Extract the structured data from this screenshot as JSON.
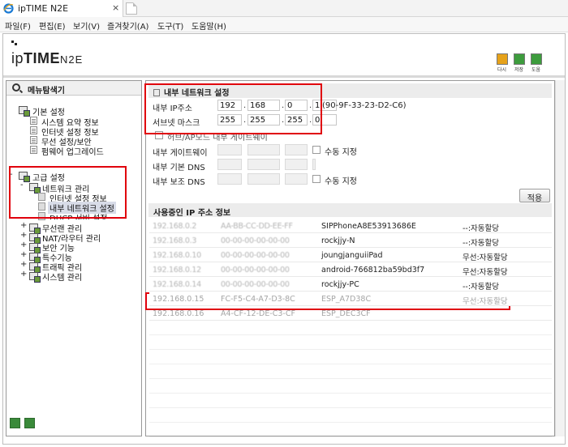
{
  "browser": {
    "tab_title": "ipTIME N2E",
    "close_glyph": "×",
    "menu": [
      "파일(F)",
      "편집(E)",
      "보기(V)",
      "즐겨찾기(A)",
      "도구(T)",
      "도움말(H)"
    ]
  },
  "header": {
    "logo_main": "ip",
    "logo_bold": "TIME",
    "logo_model": "N2E",
    "buttons": [
      {
        "label": "다시",
        "color": "#e6a21a"
      },
      {
        "label": "저장",
        "color": "#3d9c3d"
      },
      {
        "label": "도움",
        "color": "#3d9c3d"
      }
    ]
  },
  "sidebar": {
    "title": "메뉴탐색기",
    "basic": {
      "label": "기본 설정",
      "items": [
        "시스템 요약 정보",
        "인터넷 설정 정보",
        "무선 설정/보안",
        "펌웨어 업그레이드"
      ]
    },
    "advanced": {
      "label": "고급 설정",
      "network": {
        "label": "네트워크 관리",
        "items": [
          "인터넷 설정 정보",
          "내부 네트워크 설정",
          "DHCP 서버 설정"
        ]
      },
      "more": [
        "무선랜 관리",
        "NAT/라우터 관리",
        "보안 기능",
        "특수기능",
        "트래픽 관리",
        "시스템 관리"
      ]
    },
    "expand_minus": "-",
    "expand_plus": "+"
  },
  "lan": {
    "section_title": "내부 네트워크 설정",
    "ip_label": "내부 IP주소",
    "ip": [
      "192",
      "168",
      "0",
      "1"
    ],
    "mac_suffix": "(90-9F-33-23-D2-C6)",
    "mask_label": "서브넷 마스크",
    "mask": [
      "255",
      "255",
      "255",
      "0"
    ],
    "switch_mode_label": "허브/AP모드 내부 게이트웨이",
    "gateway_label": "내부 게이트웨이",
    "dns1_label": "내부 기본 DNS",
    "dns2_label": "내부 보조 DNS",
    "manual_label": "수동 지정",
    "apply": "적용"
  },
  "ipinfo": {
    "section_title": "사용중인 IP 주소 정보",
    "rows": [
      {
        "ip": "192.168.0.2",
        "mac": "AA-BB-CC-DD-EE-FF",
        "name": "SIPPhoneA8E53913686E",
        "type": "--:자동할당",
        "blur": true
      },
      {
        "ip": "192.168.0.3",
        "mac": "00-00-00-00-00-00",
        "name": "rockjjy-N",
        "type": "--:자동할당",
        "blur": true
      },
      {
        "ip": "192.168.0.10",
        "mac": "00-00-00-00-00-00",
        "name": "joungjanguiiPad",
        "type": "무선:자동할당",
        "blur": true
      },
      {
        "ip": "192.168.0.12",
        "mac": "00-00-00-00-00-00",
        "name": "android-766812ba59bd3f7",
        "type": "무선:자동할당",
        "blur": true
      },
      {
        "ip": "192.168.0.14",
        "mac": "00-00-00-00-00-00",
        "name": "rockjjy-PC",
        "type": "--:자동할당",
        "blur": true
      },
      {
        "ip": "192.168.0.15",
        "mac": "FC-F5-C4-A7-D3-8C",
        "name": "ESP_A7D38C",
        "type": "무선:자동할당",
        "blur": false
      },
      {
        "ip": "192.168.0.16",
        "mac": "A4-CF-12-DE-C3-CF",
        "name": "ESP_DEC3CF",
        "type": "",
        "blur": false
      }
    ]
  }
}
